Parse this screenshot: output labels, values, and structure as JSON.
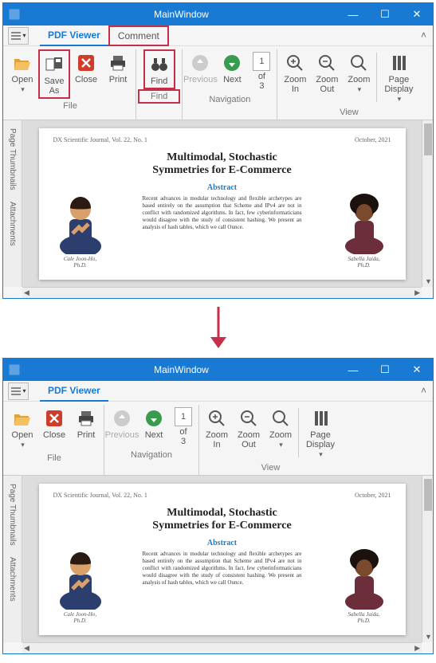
{
  "win_title": "MainWindow",
  "tabs": {
    "viewer": "PDF Viewer",
    "comment": "Comment"
  },
  "btn": {
    "open": "Open",
    "saveas": "Save\nAs",
    "close": "Close",
    "print": "Print",
    "find": "Find",
    "prev": "Previous",
    "next": "Next",
    "of3": "of\n3",
    "zin": "Zoom\nIn",
    "zout": "Zoom\nOut",
    "zoom": "Zoom",
    "pagedisp": "Page\nDisplay"
  },
  "grp": {
    "file": "File",
    "find": "Find",
    "nav": "Navigation",
    "view": "View"
  },
  "page_current": "1",
  "side": {
    "thumbs": "Page Thumbnails",
    "attach": "Attachments"
  },
  "doc": {
    "journal": "DX Scientific Journal, Vol. 22, No. 1",
    "date": "October, 2021",
    "title1": "Multimodal, Stochastic",
    "title2": "Symmetries for E-Commerce",
    "abs_head": "Abstract",
    "abs_body": "Recent advances in modular technology and flexible archetypes are based entirely on the assumption that Scheme and IPv4 are not in conflict with randomized algorithms. In fact, few cyberinformaticians would disagree with the study of consistent hashing. We present an analysis of hash tables, which we call Ounce.",
    "author_l": "Cale Joon-Ho,\nPh.D.",
    "author_r": "Sabella Jaida,\nPh.D."
  }
}
